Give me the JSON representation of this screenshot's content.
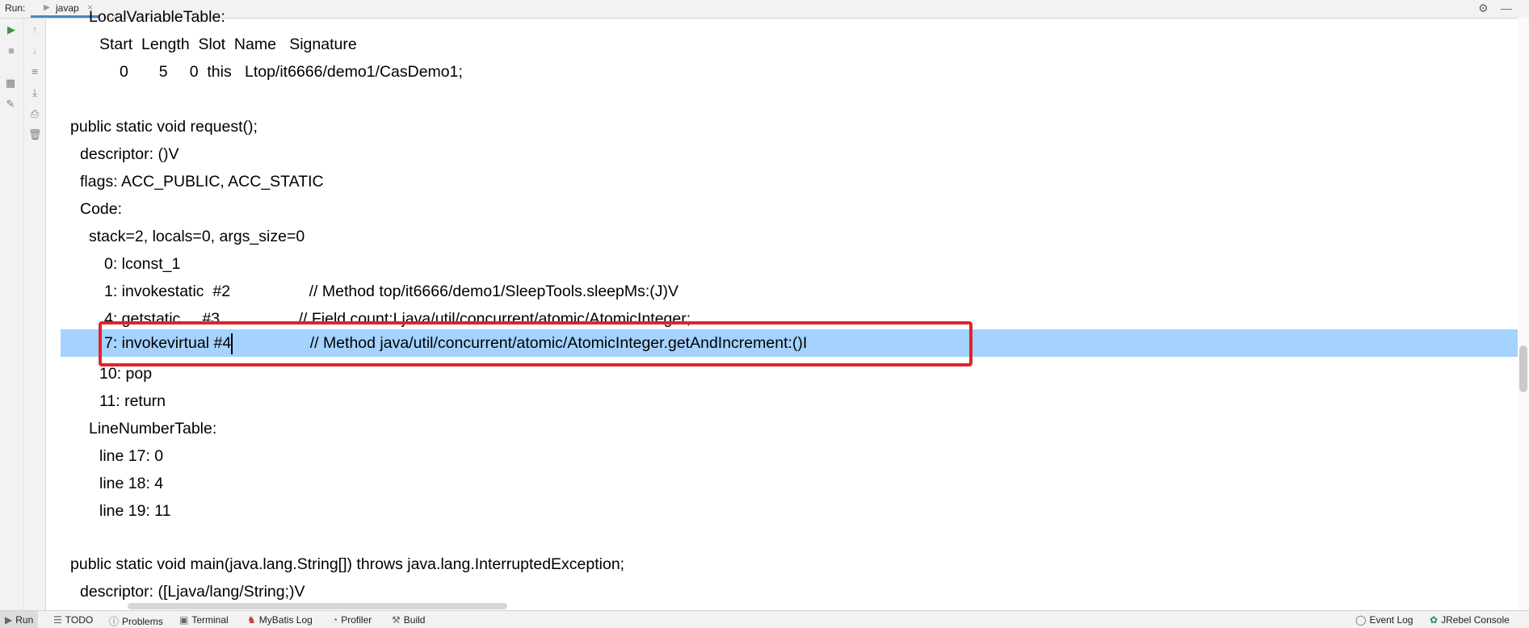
{
  "header": {
    "run_label": "Run:",
    "tab_label": "javap",
    "tab_close": "×",
    "settings_icon": "gear-icon",
    "minimize_icon": "minimize-icon"
  },
  "editor": {
    "lines": [
      "LocalVariableTable:",
      "Start  Length  Slot  Name   Signature",
      "0       5     0  this   Ltop/it6666/demo1/CasDemo1;",
      "public static void request();",
      "descriptor: ()V",
      "flags: ACC_PUBLIC, ACC_STATIC",
      "Code:",
      "stack=2, locals=0, args_size=0",
      "0: lconst_1",
      "1: invokestatic  #2                  // Method top/it6666/demo1/SleepTools.sleepMs:(J)V",
      "4: getstatic     #3                  // Field count:Ljava/util/concurrent/atomic/AtomicInteger;",
      "7: invokevirtual #4                  // Method java/util/concurrent/atomic/AtomicInteger.getAndIncrement:()I",
      "10: pop",
      "11: return",
      "LineNumberTable:",
      "line 17: 0",
      "line 18: 4",
      "line 19: 11",
      "public static void main(java.lang.String[]) throws java.lang.InterruptedException;",
      "descriptor: ([Ljava/lang/String;)V"
    ]
  },
  "bottom_bar": {
    "items": [
      {
        "label": "Run",
        "icon": "run-icon"
      },
      {
        "label": "TODO",
        "icon": "list-icon"
      },
      {
        "label": "Problems",
        "icon": "problems-icon"
      },
      {
        "label": "Terminal",
        "icon": "terminal-icon"
      },
      {
        "label": "MyBatis Log",
        "icon": "mybatis-icon"
      },
      {
        "label": "Profiler",
        "icon": "profiler-icon"
      },
      {
        "label": "Build",
        "icon": "build-icon"
      }
    ],
    "right_items": [
      {
        "label": "Event Log",
        "icon": "event-log-icon"
      },
      {
        "label": "JRebel Console",
        "icon": "jrebel-icon"
      }
    ]
  },
  "colors": {
    "selection": "#a6d2ff",
    "annotation_box": "#e0242b",
    "tab_underline": "#4a86c8"
  }
}
